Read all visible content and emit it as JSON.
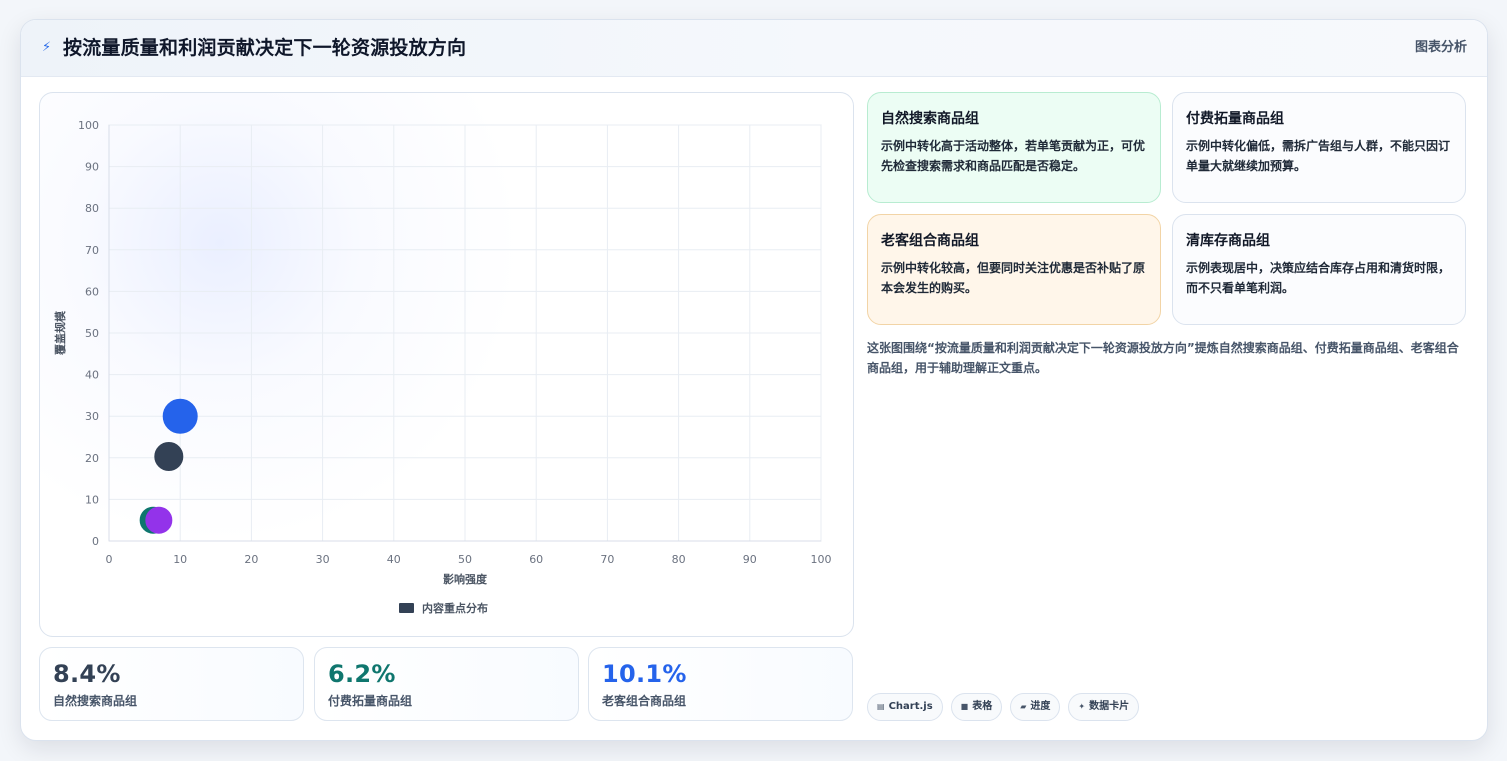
{
  "header": {
    "icon": "lightning-icon",
    "title": "按流量质量和利润贡献决定下一轮资源投放方向",
    "right_label": "图表分析"
  },
  "chart_data": {
    "type": "scatter",
    "xlabel": "影响强度",
    "ylabel": "覆盖规模",
    "xlim": [
      0,
      100
    ],
    "ylim": [
      0,
      100
    ],
    "x_ticks": [
      "0",
      "10",
      "20",
      "30",
      "40",
      "50",
      "60",
      "70",
      "80",
      "90",
      "100"
    ],
    "y_ticks": [
      "0",
      "10",
      "20",
      "30",
      "40",
      "50",
      "60",
      "70",
      "80",
      "90",
      "100"
    ],
    "grid": true,
    "legend_position": "bottom",
    "series": [
      {
        "name": "内容重点分布",
        "points": [
          {
            "x": 10,
            "y": 30,
            "color": "#2563eb"
          },
          {
            "x": 8.4,
            "y": 20.3,
            "color": "#334155"
          },
          {
            "x": 6.2,
            "y": 5,
            "color": "#0f766e"
          },
          {
            "x": 7,
            "y": 5,
            "color": "#9333ea"
          }
        ]
      }
    ],
    "legend_color": "#334155"
  },
  "stats": [
    {
      "value": "8.4%",
      "label": "自然搜索商品组",
      "color": "#334155"
    },
    {
      "value": "6.2%",
      "label": "付费拓量商品组",
      "color": "#0f766e"
    },
    {
      "value": "10.1%",
      "label": "老客组合商品组",
      "color": "#2563eb"
    }
  ],
  "info_cards": [
    {
      "title": "自然搜索商品组",
      "text": "示例中转化高于活动整体，若单笔贡献为正，可优先检查搜索需求和商品匹配是否稳定。"
    },
    {
      "title": "付费拓量商品组",
      "text": "示例中转化偏低，需拆广告组与人群，不能只因订单量大就继续加预算。"
    },
    {
      "title": "老客组合商品组",
      "text": "示例中转化较高，但要同时关注优惠是否补贴了原本会发生的购买。"
    },
    {
      "title": "清库存商品组",
      "text": "示例表现居中，决策应结合库存占用和清货时限，而不只看单笔利润。"
    }
  ],
  "summary": "这张图围绕“按流量质量和利润贡献决定下一轮资源投放方向”提炼自然搜索商品组、付费拓量商品组、老客组合商品组，用于辅助理解正文重点。",
  "tags": [
    {
      "icon": "chart-icon",
      "label": "Chart.js"
    },
    {
      "icon": "table-icon",
      "label": "表格"
    },
    {
      "icon": "progress-icon",
      "label": "进度"
    },
    {
      "icon": "sparkle-icon",
      "label": "数据卡片"
    }
  ]
}
